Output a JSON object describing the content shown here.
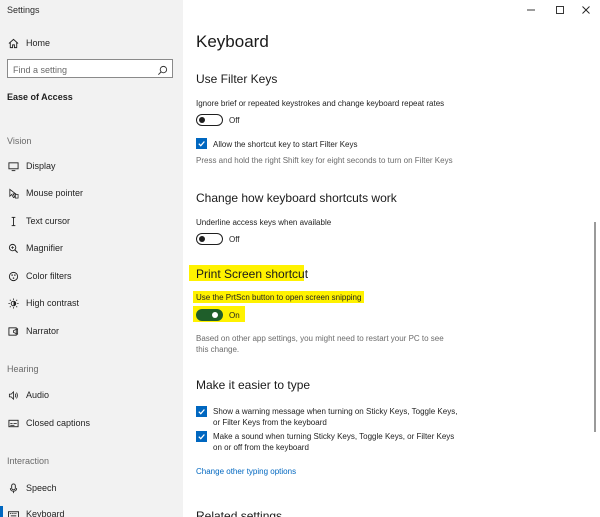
{
  "app_title": "Settings",
  "window_controls": {
    "minimize": "minimize-icon",
    "maximize": "maximize-icon",
    "close": "close-icon"
  },
  "sidebar": {
    "home_label": "Home",
    "search_placeholder": "Find a setting",
    "section_title": "Ease of Access",
    "groups": [
      {
        "label": "Vision",
        "items": [
          {
            "label": "Display",
            "icon": "display-icon"
          },
          {
            "label": "Mouse pointer",
            "icon": "mouse-pointer-icon"
          },
          {
            "label": "Text cursor",
            "icon": "text-cursor-icon"
          },
          {
            "label": "Magnifier",
            "icon": "magnifier-icon"
          },
          {
            "label": "Color filters",
            "icon": "color-filters-icon"
          },
          {
            "label": "High contrast",
            "icon": "high-contrast-icon"
          },
          {
            "label": "Narrator",
            "icon": "narrator-icon"
          }
        ]
      },
      {
        "label": "Hearing",
        "items": [
          {
            "label": "Audio",
            "icon": "audio-icon"
          },
          {
            "label": "Closed captions",
            "icon": "closed-captions-icon"
          }
        ]
      },
      {
        "label": "Interaction",
        "items": [
          {
            "label": "Speech",
            "icon": "speech-icon"
          },
          {
            "label": "Keyboard",
            "icon": "keyboard-icon",
            "selected": true
          }
        ]
      }
    ]
  },
  "main": {
    "page_title": "Keyboard",
    "filter_keys": {
      "heading": "Use Filter Keys",
      "description": "Ignore brief or repeated keystrokes and change keyboard repeat rates",
      "toggle_state": "Off",
      "checkbox_label": "Allow the shortcut key to start Filter Keys",
      "checkbox_checked": true,
      "hint": "Press and hold the right Shift key for eight seconds to turn on Filter Keys"
    },
    "shortcuts": {
      "heading": "Change how keyboard shortcuts work",
      "description": "Underline access keys when available",
      "toggle_state": "Off"
    },
    "print_screen": {
      "heading": "Print Screen shortcut",
      "description": "Use the PrtScn button to open screen snipping",
      "toggle_state": "On",
      "note_line1": "Based on other app settings, you might need to restart your PC to see",
      "note_line2": "this change."
    },
    "easier_typing": {
      "heading": "Make it easier to type",
      "cb1_line1": "Show a warning message when turning on Sticky Keys, Toggle Keys,",
      "cb1_line2": "or Filter Keys from the keyboard",
      "cb2_line1": "Make a sound when turning Sticky Keys, Toggle Keys, or Filter Keys",
      "cb2_line2": "on or off from the keyboard",
      "link": "Change other typing options"
    },
    "related_partial": "Related settings"
  },
  "colors": {
    "accent": "#0067c0",
    "highlight": "#fff200",
    "toggle_on": "#1f5e2a",
    "sidebar_bg": "#f2f2f2"
  }
}
